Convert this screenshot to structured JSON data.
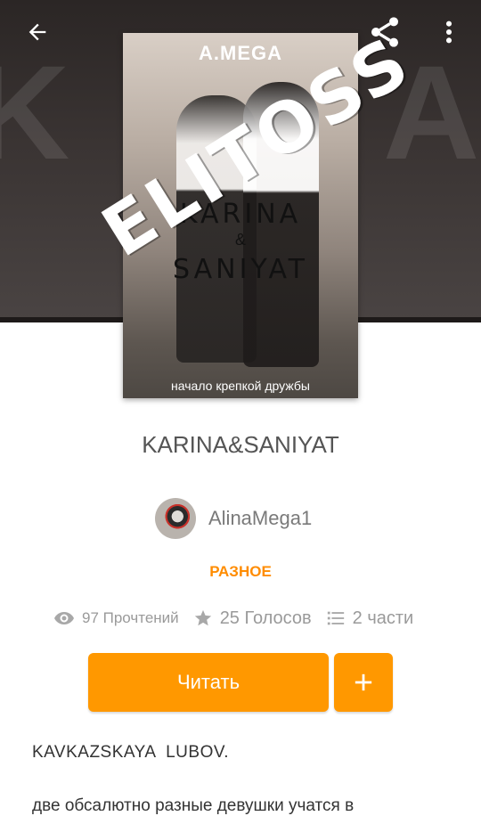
{
  "cover": {
    "brand": "A.MEGA",
    "title_line1": "KARINA",
    "title_amp": "&",
    "title_line2": "SANIYAT",
    "tagline": "начало крепкой дружбы",
    "stamp": "ELITOSS"
  },
  "story": {
    "title": "KARINA&SANIYAT",
    "author": "AlinaMega1",
    "category": "РАЗНОЕ"
  },
  "stats": {
    "reads": "97 Прочтений",
    "votes": "25 Голосов",
    "parts": "2 части"
  },
  "actions": {
    "read_label": "Читать",
    "add_label": "+"
  },
  "description": {
    "line1": "KAVKAZSKAYA  LUBOV.",
    "line2": "две обсалютно разные девушки учатся в"
  },
  "icons": {
    "back": "arrow-back-icon",
    "share": "share-icon",
    "more": "more-vert-icon",
    "eye": "eye-icon",
    "star": "star-icon",
    "list": "list-icon",
    "plus": "plus-icon"
  },
  "colors": {
    "accent": "#ff9800",
    "category": "#ff8c00",
    "muted": "#9a9a9a"
  }
}
